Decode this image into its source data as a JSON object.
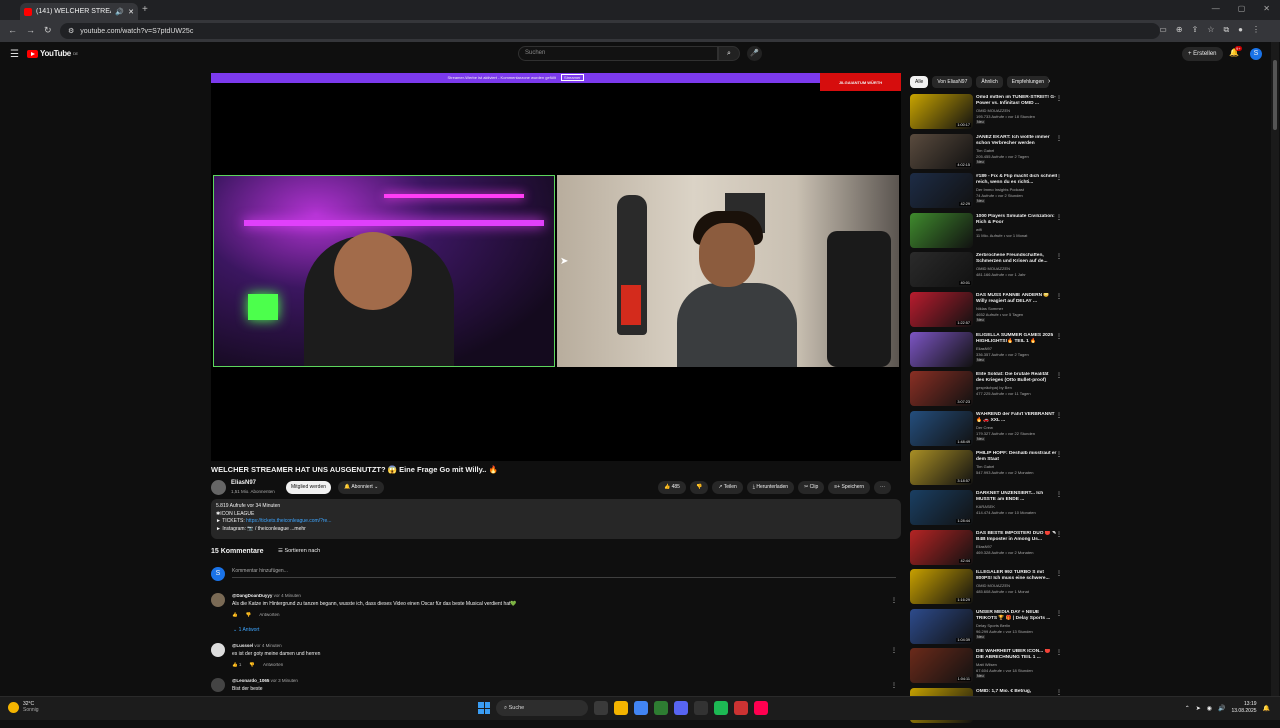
{
  "browser": {
    "tab_title": "(141) WELCHER STREAMER",
    "url": "youtube.com/watch?v=S7ptdUW25c",
    "new_tab": "+",
    "window_controls": [
      "—",
      "▢",
      "✕"
    ]
  },
  "youtube": {
    "logo_text": "YouTube",
    "logo_sup": "DE",
    "search_placeholder": "Suchen",
    "create_label": "+ Erstellen",
    "notification_count": "9+",
    "user_initial": "S"
  },
  "player": {
    "banner_text": "Streamer-Werbe ist aktiviert - Kommentarzone wurden gefüllt",
    "banner_button": "Streamer",
    "sponsor_text": "JILGAIANTUM WÜRTH"
  },
  "video": {
    "title": "WELCHER STREAMER HAT UNS AUSGENUTZT? 😱 Eine Frage Go mit Willy.. 🔥",
    "channel_name": "EliasN97",
    "subscribers": "1,51 Mio. Abonnenten",
    "join_label": "Mitglied werden",
    "subscribe_label": "🔔 Abonniert ⌄",
    "likes": "👍 485",
    "dislike": "👎",
    "share": "↗ Teilen",
    "download": "⤓ Herunterladen",
    "clip": "✂ Clip",
    "save": "≡+ Speichern",
    "more": "···",
    "description": {
      "line1": "5.819 Aufrufe  vor 34 Minuten",
      "line2": "✱ICON LEAGUE",
      "line3_prefix": "► TICKETS: ",
      "line3_link": "https://tickets.theiconleague.com/?re...",
      "line4": "► Instagram: 📷 / theiconleague   ...mehr"
    }
  },
  "comments": {
    "header": "15 Kommentare",
    "sort_label": "☰ Sortieren nach",
    "add_placeholder": "Kommentar hinzufügen...",
    "items": [
      {
        "user": "@DangDoanDuyyy",
        "time": "vor 4 Minuten",
        "text": "Als die Katze im Hintergrund zu tanzen begann, wusste ich, dass dieses Video einen Oscar für das beste Musical verdient hat💚",
        "likes": "👍",
        "reply": "Antworten"
      },
      {
        "user": "@Lusssel",
        "time": "vor 4 Minuten",
        "text": "es ist der goty meine damen und herren",
        "likes": "👍 1",
        "reply": "Antworten"
      },
      {
        "user": "@Leonardo_1065",
        "time": "vor 3 Minuten",
        "text": "Bist der beste",
        "likes": "",
        "reply": ""
      }
    ],
    "reply_link": "⌄ 1 Antwort"
  },
  "sidebar": {
    "chips": [
      "Alle",
      "Von EliasN97",
      "Ähnlich",
      "Empfehlungen"
    ],
    "recommendations": [
      {
        "title": "Omid mitten im TUNER-STREIT! G-Power vs. Infinitas! OMID ...",
        "channel": "OMID MOUAZZEN",
        "views": "195.733 Aufrufe • vor 18 Stunden",
        "badge": "Neu",
        "duration": "1:00:17",
        "color": "#c9a400"
      },
      {
        "title": "JANEZ EKART: Ich wollte immer schon Verbrecher werden",
        "channel": "Tim Gabel",
        "views": "205.455 Aufrufe • vor 2 Tagen",
        "badge": "Neu",
        "duration": "4:02:15",
        "color": "#5a4b3e"
      },
      {
        "title": "#189 - Fix & Flip macht dich schnell reich, wenn du es richti...",
        "channel": "Der Immo Insights Podcast",
        "views": "74 Aufrufe • vor 2 Stunden",
        "badge": "Neu",
        "duration": "42:29",
        "color": "#1d2c46"
      },
      {
        "title": "1000 Players Simulate Civilization: Rich & Poor",
        "channel": "wifi",
        "views": "11 Mio. Aufrufe • vor 1 Monat",
        "badge": "",
        "duration": "",
        "color": "#3f8a2d"
      },
      {
        "title": "Zerbrochene Freundschaften, Schmerzen und Krisen auf de...",
        "channel": "OMID MOUAZZEN",
        "views": "481.166 Aufrufe • vor 1 Jahr",
        "badge": "",
        "duration": "40:01",
        "color": "#2b2b2b"
      },
      {
        "title": "DAS MUSS FANNIE ÄNDERN 😳 Willy reagiert auf DELAY ...",
        "channel": "Niklas Sommer",
        "views": "4652 Aufrufe • vor 5 Tagen",
        "badge": "Neu",
        "duration": "1:22:57",
        "color": "#b91c2e"
      },
      {
        "title": "ELIGELLA SUMMER GAMES 2025 HIGHLIGHTS!🔥 TEIL 1 🔥",
        "channel": "EliasN97",
        "views": "336.357 Aufrufe • vor 2 Tagen",
        "badge": "Neu",
        "duration": "",
        "color": "#7c55c4"
      },
      {
        "title": "Elite Soldat: Die brutale Realität des Krieges (Otto Bullet-proof)",
        "channel": "gesprächpa) by Ben",
        "views": "477.225 Aufrufe • vor 11 Tagen",
        "badge": "",
        "duration": "3:07:23",
        "color": "#8a2f24"
      },
      {
        "title": "WÄHREND der Fahrt VERBRANNT 🔥 🚗 XXL ...",
        "channel": "Der Crew",
        "views": "179.327 Aufrufe • vor 22 Stunden",
        "badge": "Neu",
        "duration": "1:48:49",
        "color": "#244e7d"
      },
      {
        "title": "PHILIP HOPF: Deshalb misstraut er dem Staat",
        "channel": "Tim Gabel",
        "views": "547.993 Aufrufe • vor 2 Monaten",
        "badge": "",
        "duration": "3:18:57",
        "color": "#a98f25"
      },
      {
        "title": "DARKNET UNZENSIERT... Ich MUSSTE am ENDE ...",
        "channel": "KARASEK",
        "views": "414.474 Aufrufe • vor 10 Monaten",
        "badge": "",
        "duration": "1:28:44",
        "color": "#1a3f63"
      },
      {
        "title": "DAS BESTE IMPOSTER! DUO 🔴 ✎ B4B Imposter in Among Us...",
        "channel": "EliasN97",
        "views": "469.328 Aufrufe • vor 2 Monaten",
        "badge": "",
        "duration": "42:44",
        "color": "#b52424"
      },
      {
        "title": "ILLEGALER 992 TURBO S mit 800PS! Ich muss eine schwere...",
        "channel": "OMID MOUAZZEN",
        "views": "485.608 Aufrufe • vor 1 Monat",
        "badge": "",
        "duration": "1:16:29",
        "color": "#c8a000"
      },
      {
        "title": "UNSER MEDIA DAY + NEUE TRIKOTS 🏆 🎁 | Delay Sports ...",
        "channel": "Delay Sports Berlin",
        "views": "96.299 Aufrufe • vor 13 Stunden",
        "badge": "Neu",
        "duration": "1:04:39",
        "color": "#2d4b8c"
      },
      {
        "title": "DIE WAHRHEIT ÜBER ICON... 🔴 DIE ABRECHNUNG TEIL 1 ...",
        "channel": "Matt Wilsen",
        "views": "67.604 Aufrufe • vor 18 Stunden",
        "badge": "Neu",
        "duration": "1:04:11",
        "color": "#6b2a1a"
      },
      {
        "title": "OMID: 1,7 Mio. € Betrug,",
        "channel": "",
        "views": "",
        "badge": "",
        "duration": "",
        "color": "#c4a000"
      }
    ]
  },
  "taskbar": {
    "temp": "32°C",
    "condition": "Sonnig",
    "search_label": "Suche",
    "time": "13:19",
    "date": "13.08.2025",
    "app_colors": [
      "#3a3a3a",
      "#f4b400",
      "#4285f4",
      "#2e7d32",
      "#5865f2",
      "#333333",
      "#1db954",
      "#cc3333",
      "#ff0050"
    ]
  }
}
